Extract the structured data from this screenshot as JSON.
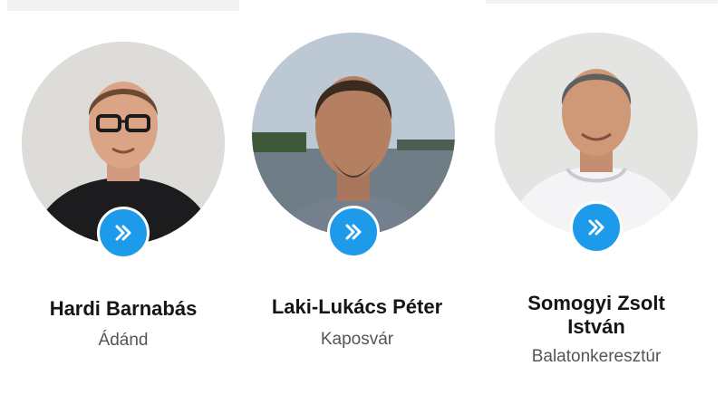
{
  "colors": {
    "accent": "#1d9bea",
    "name_text": "#151515",
    "city_text": "#555555"
  },
  "people": [
    {
      "name": "Hardi Barnabás",
      "city": "Ádánd",
      "button_icon": "double-chevron-right-icon"
    },
    {
      "name": "Laki-Lukács Péter",
      "city": "Kaposvár",
      "button_icon": "double-chevron-right-icon"
    },
    {
      "name": "Somogyi Zsolt István",
      "city": "Balatonkeresztúr",
      "button_icon": "double-chevron-right-icon"
    }
  ]
}
